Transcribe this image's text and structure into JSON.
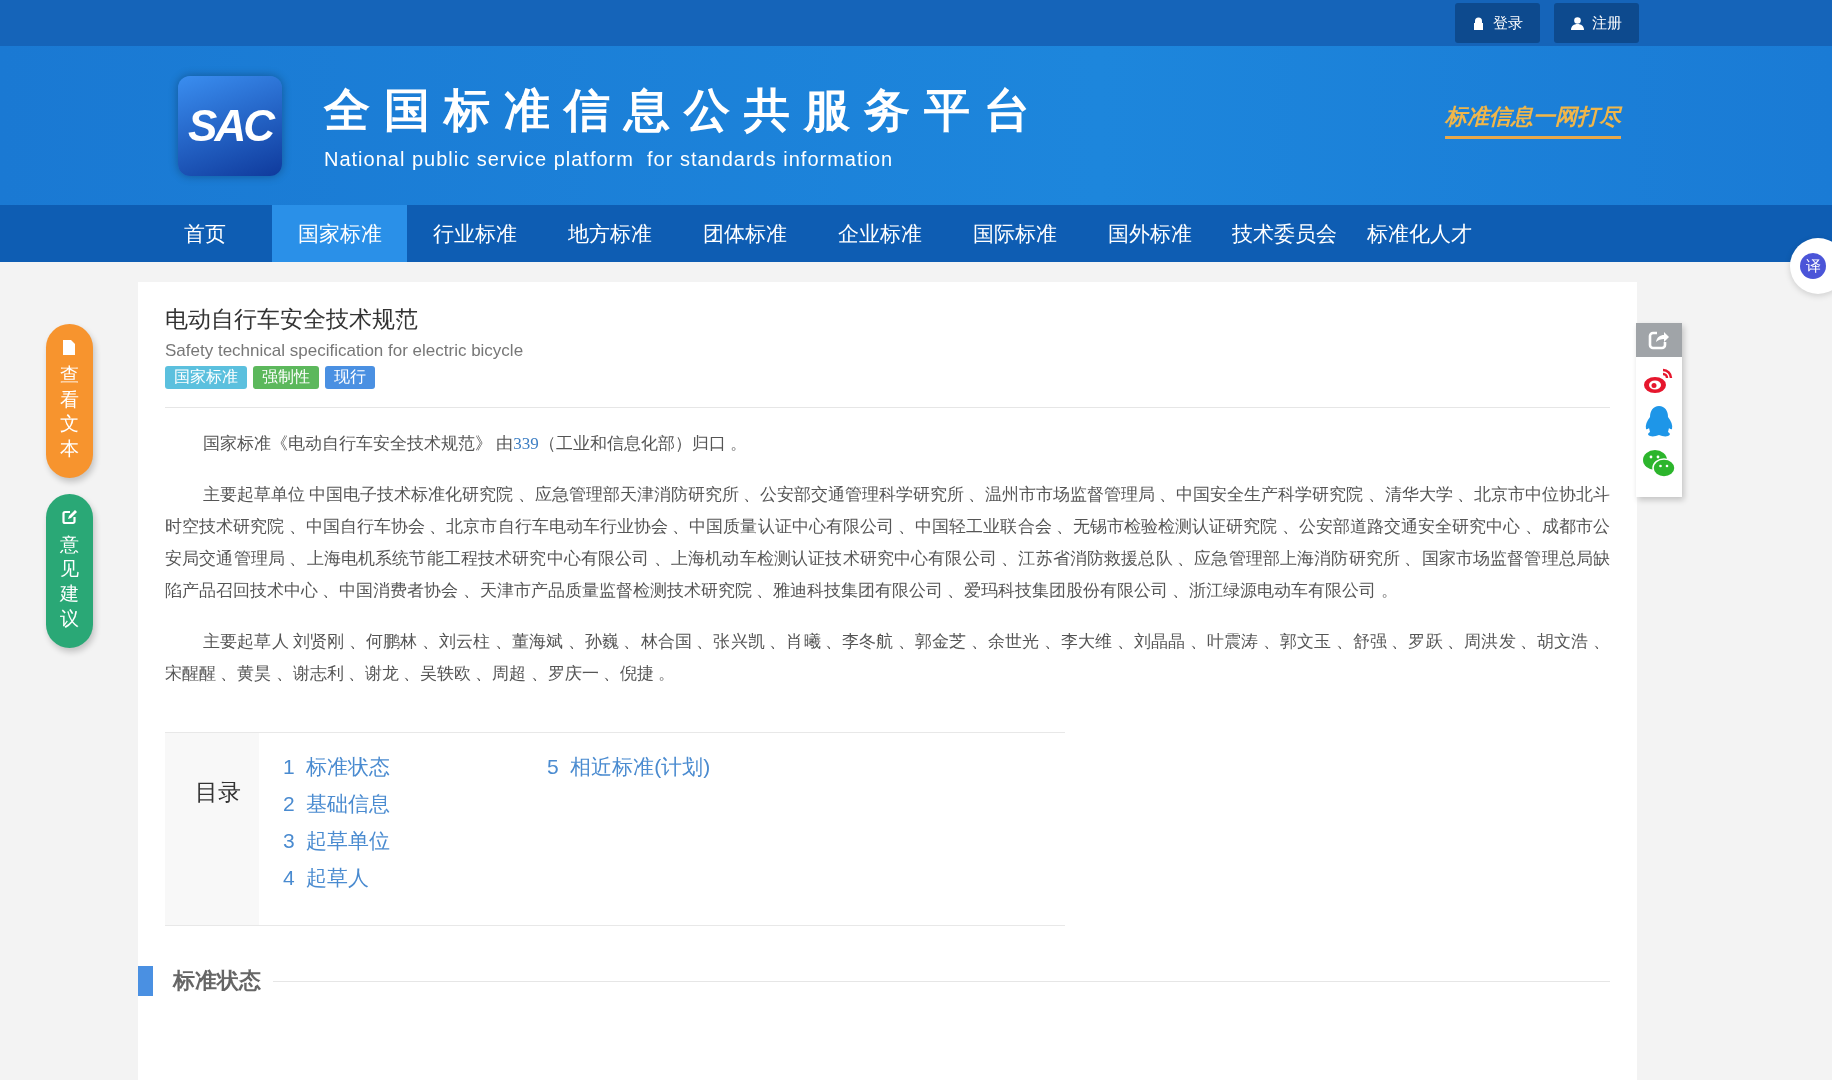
{
  "top_bar": {
    "buttons": [
      {
        "label": "登录",
        "kind": "lock"
      },
      {
        "label": "注册",
        "kind": "user"
      }
    ]
  },
  "header": {
    "logo_text": "SAC",
    "title": "全国标准信息公共服务平台",
    "subtitle": "National public service platform  for standards information",
    "slogan": "标准信息一网打尽"
  },
  "nav": [
    {
      "label": "首页",
      "selected": false
    },
    {
      "label": "国家标准",
      "selected": true
    },
    {
      "label": "行业标准",
      "selected": false
    },
    {
      "label": "地方标准",
      "selected": false
    },
    {
      "label": "团体标准",
      "selected": false
    },
    {
      "label": "企业标准",
      "selected": false
    },
    {
      "label": "国际标准",
      "selected": false
    },
    {
      "label": "国外标准",
      "selected": false
    },
    {
      "label": "技术委员会",
      "selected": false
    },
    {
      "label": "标准化人才",
      "selected": false
    }
  ],
  "side_actions": [
    {
      "label": "查看文本",
      "kind": "document"
    },
    {
      "label": "意见建议",
      "kind": "edit"
    }
  ],
  "translate": {
    "label": "译"
  },
  "standard": {
    "title": "电动自行车安全技术规范",
    "subtitle": "Safety technical specification for electric bicycle",
    "tags": [
      {
        "label": "国家标准",
        "color": "#5bc0de"
      },
      {
        "label": "强制性",
        "color": "#5cb85c"
      },
      {
        "label": "现行",
        "color": "#4a90e2"
      }
    ]
  },
  "intro": {
    "before": "国家标准《电动自行车安全技术规范》 由",
    "link": "339",
    "after": "（工业和信息化部）归口 。"
  },
  "paragraphs": [
    "主要起草单位 中国电子技术标准化研究院 、应急管理部天津消防研究所 、公安部交通管理科学研究所 、温州市市场监督管理局 、中国安全生产科学研究院 、清华大学 、北京市中位协北斗时空技术研究院 、中国自行车协会 、北京市自行车电动车行业协会 、中国质量认证中心有限公司 、中国轻工业联合会 、无锡市检验检测认证研究院 、公安部道路交通安全研究中心 、成都市公安局交通管理局 、上海电机系统节能工程技术研究中心有限公司 、上海机动车检测认证技术研究中心有限公司 、江苏省消防救援总队 、应急管理部上海消防研究所 、国家市场监督管理总局缺陷产品召回技术中心 、中国消费者协会 、天津市产品质量监督检测技术研究院 、雅迪科技集团有限公司 、爱玛科技集团股份有限公司 、浙江绿源电动车有限公司 。",
    "主要起草人 刘贤刚 、何鹏林 、刘云柱 、董海斌 、孙巍 、林合国 、张兴凯 、肖曦 、李冬航 、郭金芝 、余世光 、李大维 、刘晶晶 、叶震涛 、郭文玉 、舒强 、罗跃 、周洪发 、胡文浩 、宋醒醒 、黄昊 、谢志利 、谢龙 、吴轶欧 、周超 、罗庆一 、倪捷 。"
  ],
  "toc": {
    "label": "目录",
    "items": [
      {
        "number": "1",
        "label": "标准状态"
      },
      {
        "number": "2",
        "label": "基础信息"
      },
      {
        "number": "3",
        "label": "起草单位"
      },
      {
        "number": "4",
        "label": "起草人"
      },
      {
        "number": "5",
        "label": "相近标准(计划)"
      }
    ]
  },
  "section": {
    "title": "标准状态"
  }
}
